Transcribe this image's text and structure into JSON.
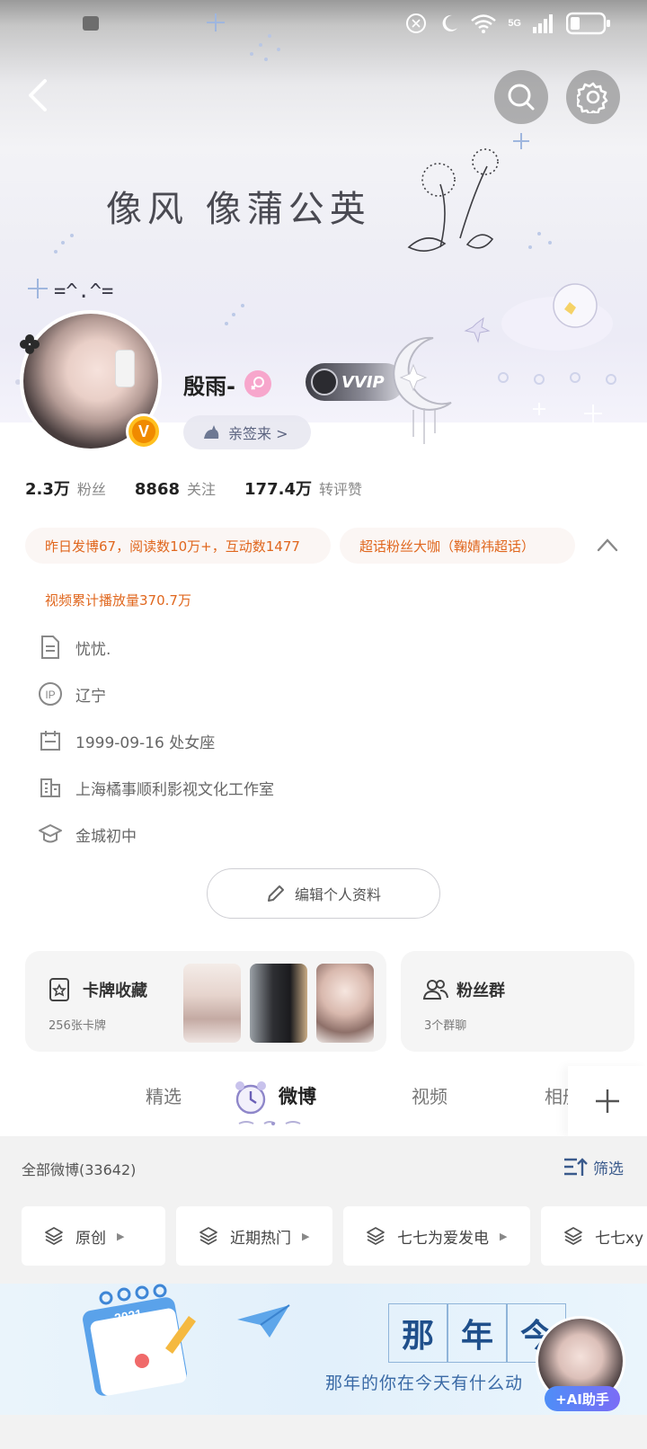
{
  "banner": {
    "script_text": "像风 像蒲公英",
    "face_text": "=^.^="
  },
  "status_bar": {
    "network": "5G",
    "icons": [
      "sync-icon",
      "moon-icon",
      "wifi-icon",
      "signal-icon",
      "battery-icon"
    ]
  },
  "nav": {
    "icons": [
      "back-icon",
      "search-icon",
      "gear-icon"
    ]
  },
  "profile": {
    "username": "殷雨-",
    "vvip_text": "VVIP",
    "signin_text": "亲签来 >",
    "stats": [
      {
        "value": "2.3万",
        "label": "粉丝"
      },
      {
        "value": "8868",
        "label": "关注"
      },
      {
        "value": "177.4万",
        "label": "转评赞"
      }
    ],
    "verified_text": "V"
  },
  "honors": {
    "line1": "昨日发博67，阅读数10万+，互动数1477",
    "line2": "超话粉丝大咖（鞠婧祎超话）",
    "line3": "视频累计播放量370.7万"
  },
  "info": {
    "bio": "忧忧.",
    "ip": "辽宁",
    "ip_icon_text": "IP",
    "birthday": "1999-09-16 处女座",
    "company": "上海橘事顺利影视文化工作室",
    "school": "金城初中",
    "edit_button": "编辑个人资料"
  },
  "cards": {
    "card_collection_title": "卡牌收藏",
    "card_collection_sub": "256张卡牌",
    "fan_group_title": "粉丝群",
    "fan_group_sub": "3个群聊"
  },
  "tabs": {
    "items": [
      "精选",
      "微博",
      "视频",
      "相册"
    ],
    "active": "微博",
    "add_icon": "plus-icon"
  },
  "feed": {
    "count_label": "全部微博(33642)",
    "filter_label": "筛选",
    "chips": [
      "原创",
      "近期热门",
      "七七为爱发电",
      "七七xy"
    ]
  },
  "promo": {
    "grid_chars": [
      "那",
      "年",
      "今"
    ],
    "subtitle": "那年的你在今天有什么动",
    "calendar_year": "2021",
    "ai_label": "+AI助手"
  },
  "colors": {
    "honor_text": "#e0671e",
    "accent_blue": "#3a5a8c",
    "vip_gold": "#ffbf1f"
  }
}
